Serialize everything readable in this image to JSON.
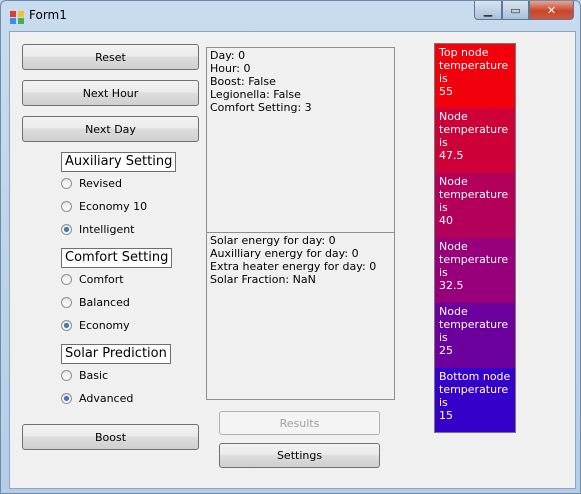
{
  "window": {
    "title": "Form1"
  },
  "buttons": {
    "reset": "Reset",
    "next_hour": "Next Hour",
    "next_day": "Next Day",
    "boost": "Boost",
    "results": "Results",
    "settings": "Settings"
  },
  "groups": {
    "auxiliary": {
      "label": "Auxiliary Setting",
      "options": [
        "Revised",
        "Economy 10",
        "Intelligent"
      ],
      "selected": "Intelligent"
    },
    "comfort": {
      "label": "Comfort Setting",
      "options": [
        "Comfort",
        "Balanced",
        "Economy"
      ],
      "selected": "Economy"
    },
    "solar": {
      "label": "Solar Prediction",
      "options": [
        "Basic",
        "Advanced"
      ],
      "selected": "Advanced"
    }
  },
  "status_panel": {
    "lines": [
      "Day: 0",
      "Hour: 0",
      "Boost: False",
      "Legionella: False",
      "Comfort Setting: 3"
    ]
  },
  "energy_panel": {
    "lines": [
      "Solar energy for day: 0",
      "Auxilliary energy for day: 0",
      "Extra heater energy for day: 0",
      "Solar Fraction: NaN"
    ]
  },
  "nodes": [
    {
      "lines": [
        "Top node",
        "temperature is",
        "55"
      ],
      "color": "#f2000b"
    },
    {
      "lines": [
        "Node",
        "temperature is",
        "47.5"
      ],
      "color": "#cd0038"
    },
    {
      "lines": [
        "Node",
        "temperature is",
        "40"
      ],
      "color": "#b3005a"
    },
    {
      "lines": [
        "Node",
        "temperature is",
        "32.5"
      ],
      "color": "#97007a"
    },
    {
      "lines": [
        "Node",
        "temperature is",
        "25"
      ],
      "color": "#6c009d"
    },
    {
      "lines": [
        "Bottom node",
        "temperature is",
        "15"
      ],
      "color": "#3500c9"
    }
  ]
}
